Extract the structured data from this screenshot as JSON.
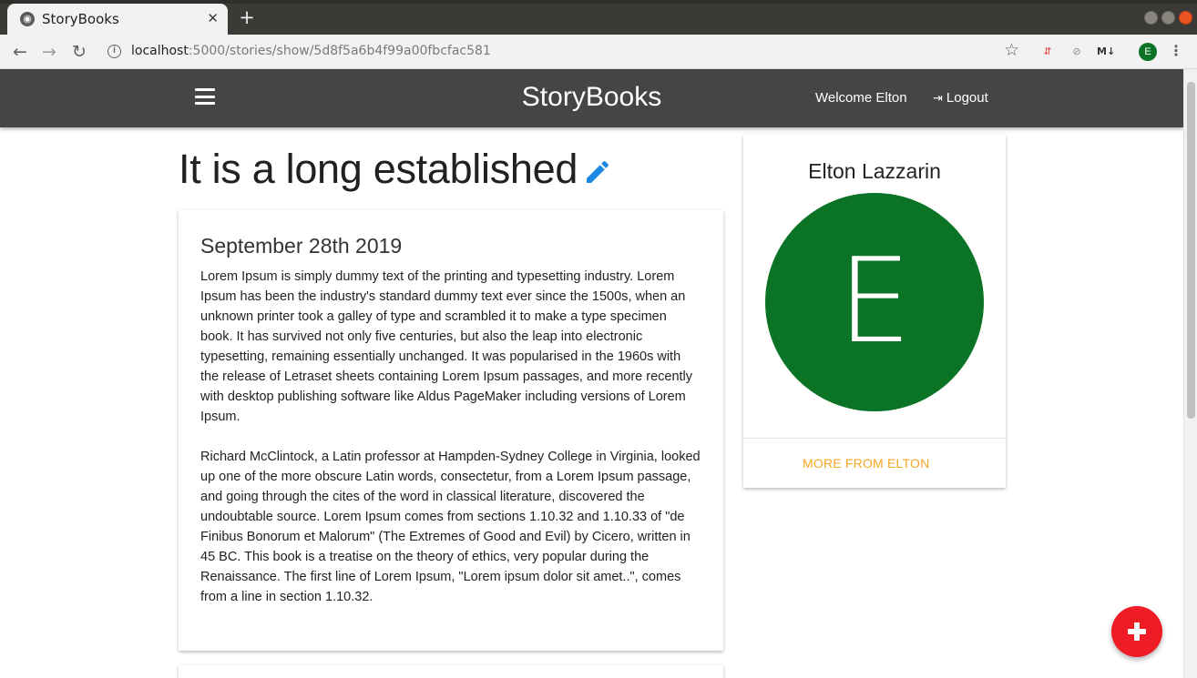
{
  "browser": {
    "tab_title": "StoryBooks",
    "tab_close": "✕",
    "new_tab": "+",
    "url_host": "localhost",
    "url_path": ":5000/stories/show/5d8f5a6b4f99a00fbcfac581",
    "profile_initial": "E",
    "extensions": [
      "⇵",
      "⊘",
      "M↓"
    ]
  },
  "navbar": {
    "brand": "StoryBooks",
    "welcome": "Welcome Elton",
    "logout_label": "Logout",
    "background": "#454545"
  },
  "story": {
    "title": "It is a long established",
    "date": "September 28th 2019",
    "paragraphs": [
      "Lorem Ipsum is simply dummy text of the printing and typesetting industry. Lorem Ipsum has been the industry's standard dummy text ever since the 1500s, when an unknown printer took a galley of type and scrambled it to make a type specimen book. It has survived not only five centuries, but also the leap into electronic typesetting, remaining essentially unchanged. It was popularised in the 1960s with the release of Letraset sheets containing Lorem Ipsum passages, and more recently with desktop publishing software like Aldus PageMaker including versions of Lorem Ipsum.",
      "Richard McClintock, a Latin professor at Hampden-Sydney College in Virginia, looked up one of the more obscure Latin words, consectetur, from a Lorem Ipsum passage, and going through the cites of the word in classical literature, discovered the undoubtable source. Lorem Ipsum comes from sections 1.10.32 and 1.10.33 of \"de Finibus Bonorum et Malorum\" (The Extremes of Good and Evil) by Cicero, written in 45 BC. This book is a treatise on the theory of ethics, very popular during the Renaissance. The first line of Lorem Ipsum, \"Lorem ipsum dolor sit amet..\", comes from a line in section 1.10.32."
    ],
    "edit_icon_color": "#1e88e5"
  },
  "author": {
    "name": "Elton Lazzarin",
    "initial": "E",
    "avatar_color": "#0a7325",
    "more_link": "MORE FROM ELTON",
    "link_color": "#f5a623"
  },
  "fab": {
    "color": "#ee1c25"
  }
}
